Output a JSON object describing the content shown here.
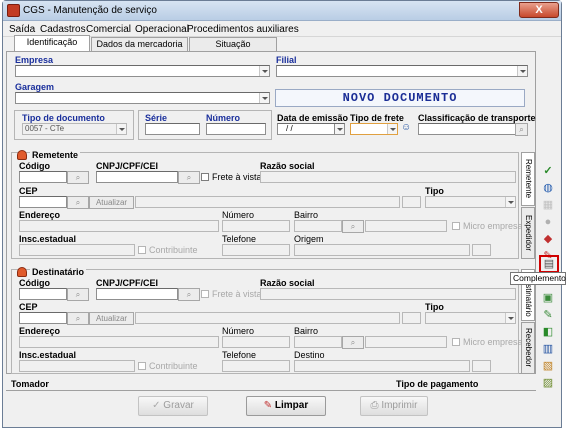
{
  "window": {
    "title": "CGS - Manutenção de serviço",
    "close_label": "X"
  },
  "menu": [
    "Saída",
    "Cadastros",
    "Comercial",
    "Operacional",
    "Procedimentos auxiliares"
  ],
  "tabs": [
    "Identificação",
    "Dados da mercadoria",
    "Situação"
  ],
  "header": {
    "empresa_label": "Empresa",
    "filial_label": "Filial",
    "garagem_label": "Garagem",
    "doc_status": "NOVO DOCUMENTO",
    "tipo_doc_label": "Tipo de documento",
    "tipo_doc_value": "0057 - CTe",
    "serie_label": "Série",
    "numero_label": "Número",
    "data_emissao_label": "Data de emissão",
    "data_emissao_value": "/ /",
    "tipo_frete_label": "Tipo de frete",
    "classificacao_label": "Classificação de transporte"
  },
  "remetente": {
    "title": "Remetente",
    "codigo": "Código",
    "cnpj": "CNPJ/CPF/CEI",
    "frete_vista": "Frete à vista",
    "razao": "Razão social",
    "cep": "CEP",
    "atualizar": "Atualizar",
    "tipo": "Tipo",
    "endereco": "Endereço",
    "numero": "Número",
    "bairro": "Bairro",
    "micro": "Micro empresa",
    "insc": "Insc.estadual",
    "contribuinte": "Contribuinte",
    "telefone": "Telefone",
    "origem": "Origem"
  },
  "destinatario": {
    "title": "Destinatário",
    "codigo": "Código",
    "cnpj": "CNPJ/CPF/CEI",
    "frete_vista": "Frete à vista",
    "razao": "Razão social",
    "cep": "CEP",
    "atualizar": "Atualizar",
    "tipo": "Tipo",
    "endereco": "Endereço",
    "numero": "Número",
    "bairro": "Bairro",
    "micro": "Micro empresa",
    "insc": "Insc.estadual",
    "contribuinte": "Contribuinte",
    "telefone": "Telefone",
    "destino": "Destino"
  },
  "side_tabs": [
    "Remetente",
    "Expedidor",
    "Destinatário",
    "Recebedor"
  ],
  "footer": {
    "tomador": "Tomador",
    "tipo_pagamento": "Tipo de pagamento"
  },
  "buttons": {
    "gravar": "Gravar",
    "limpar": "Limpar",
    "imprimir": "Imprimir"
  },
  "tooltip": "Complemento",
  "colors": {
    "label_blue": "#1a2f9c",
    "doc_status": "#1b2e96",
    "highlight": "#d00000"
  }
}
